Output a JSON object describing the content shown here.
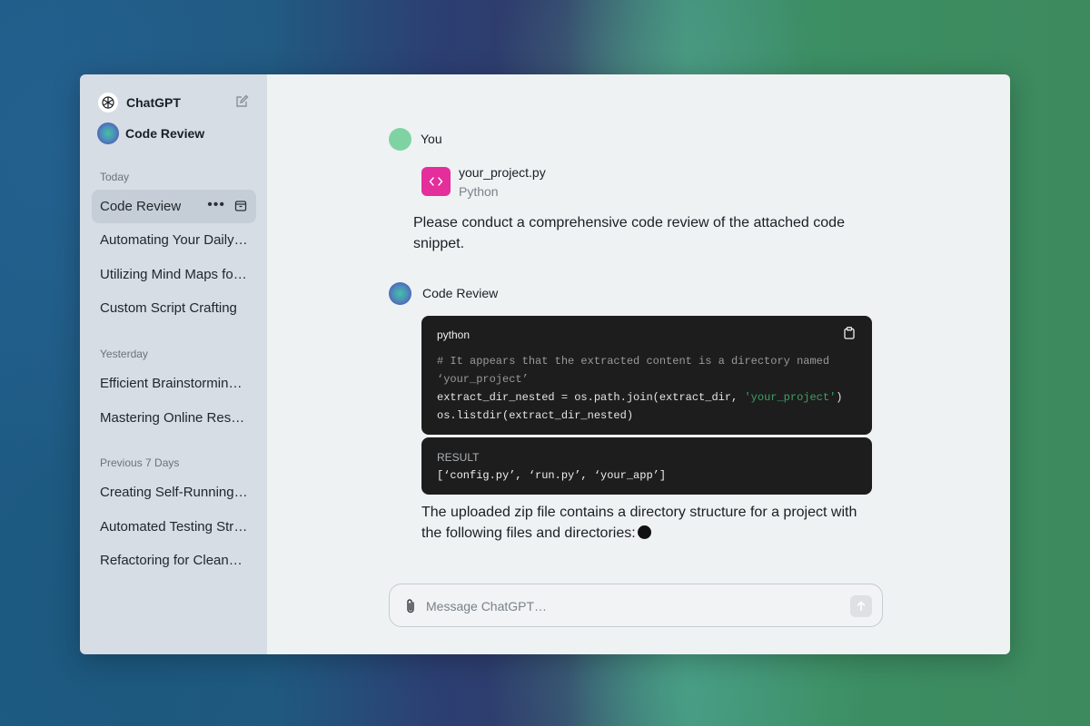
{
  "sidebar": {
    "app_name": "ChatGPT",
    "gpt_name": "Code Review",
    "sections": [
      {
        "label": "Today",
        "items": [
          "Code Review",
          "Automating Your Daily Tasks",
          "Utilizing Mind Maps for Planning",
          "Custom Script Crafting"
        ]
      },
      {
        "label": "Yesterday",
        "items": [
          "Efficient Brainstorming Techniques",
          "Mastering Online Research"
        ]
      },
      {
        "label": "Previous 7 Days",
        "items": [
          "Creating Self-Running Scripts",
          "Automated Testing Strategies",
          "Refactoring for Cleaner Code"
        ]
      }
    ],
    "active_item": "Code Review",
    "item_menu_glyph": "•••"
  },
  "conversation": {
    "user": {
      "name": "You",
      "attachment": {
        "file_name": "your_project.py",
        "file_type": "Python",
        "icon": "code-brackets-icon"
      },
      "message": "Please conduct a comprehensive code review of the attached code snippet."
    },
    "assistant": {
      "name": "Code Review",
      "code_block": {
        "language": "python",
        "comment_line1": "# It appears that the extracted content is a directory named",
        "comment_line2": "‘your_project’",
        "line3_prefix": "extract_dir_nested = os.path.join(extract_dir, ",
        "line3_string": "'your_project'",
        "line3_suffix": ")",
        "line4": "os.listdir(extract_dir_nested)"
      },
      "result": {
        "label": "RESULT",
        "value": "[‘config.py’, ‘run.py’, ‘your_app’]"
      },
      "message": "The uploaded zip file contains a directory structure for a project with the following files and directories:"
    }
  },
  "composer": {
    "placeholder": "Message ChatGPT…",
    "value": ""
  },
  "colors": {
    "sidebar_bg": "#d6dde4",
    "main_bg": "#eff2f3",
    "user_avatar": "#7fd3a3",
    "file_icon_bg": "#e32e9b",
    "code_bg": "#1d1d1d",
    "string_green": "#3fa063"
  }
}
